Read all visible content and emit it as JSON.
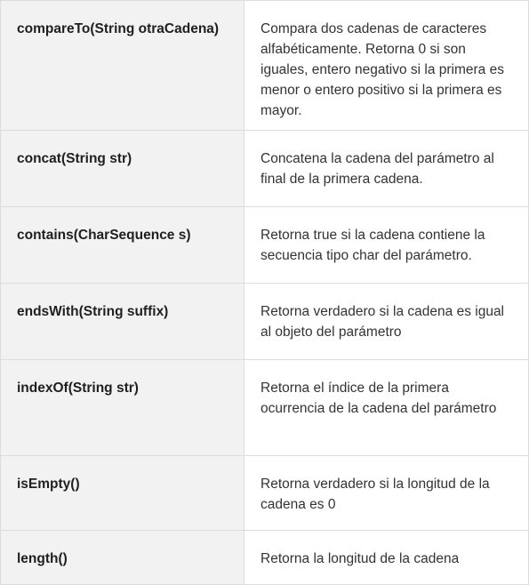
{
  "rows": [
    {
      "method": "compareTo(String otraCadena)",
      "description": "Compara dos cadenas de caracteres alfabéticamente. Retorna 0 si son iguales, entero negativo si la primera es menor o entero positivo si la primera es mayor."
    },
    {
      "method": "concat(String str)",
      "description": "Concatena la cadena del parámetro al final de la primera cadena."
    },
    {
      "method": "contains(CharSequence s)",
      "description": "Retorna true si la cadena contiene la secuencia tipo char del parámetro."
    },
    {
      "method": "endsWith(String suffix)",
      "description": "Retorna verdadero si la cadena es igual al objeto del parámetro"
    },
    {
      "method": "indexOf(String str)",
      "description": "Retorna el índice de la primera ocurrencia de la cadena del parámetro"
    },
    {
      "method": "isEmpty()",
      "description": "Retorna verdadero si la longitud de la cadena es 0"
    },
    {
      "method": "length()",
      "description": "Retorna la longitud de la cadena"
    }
  ]
}
